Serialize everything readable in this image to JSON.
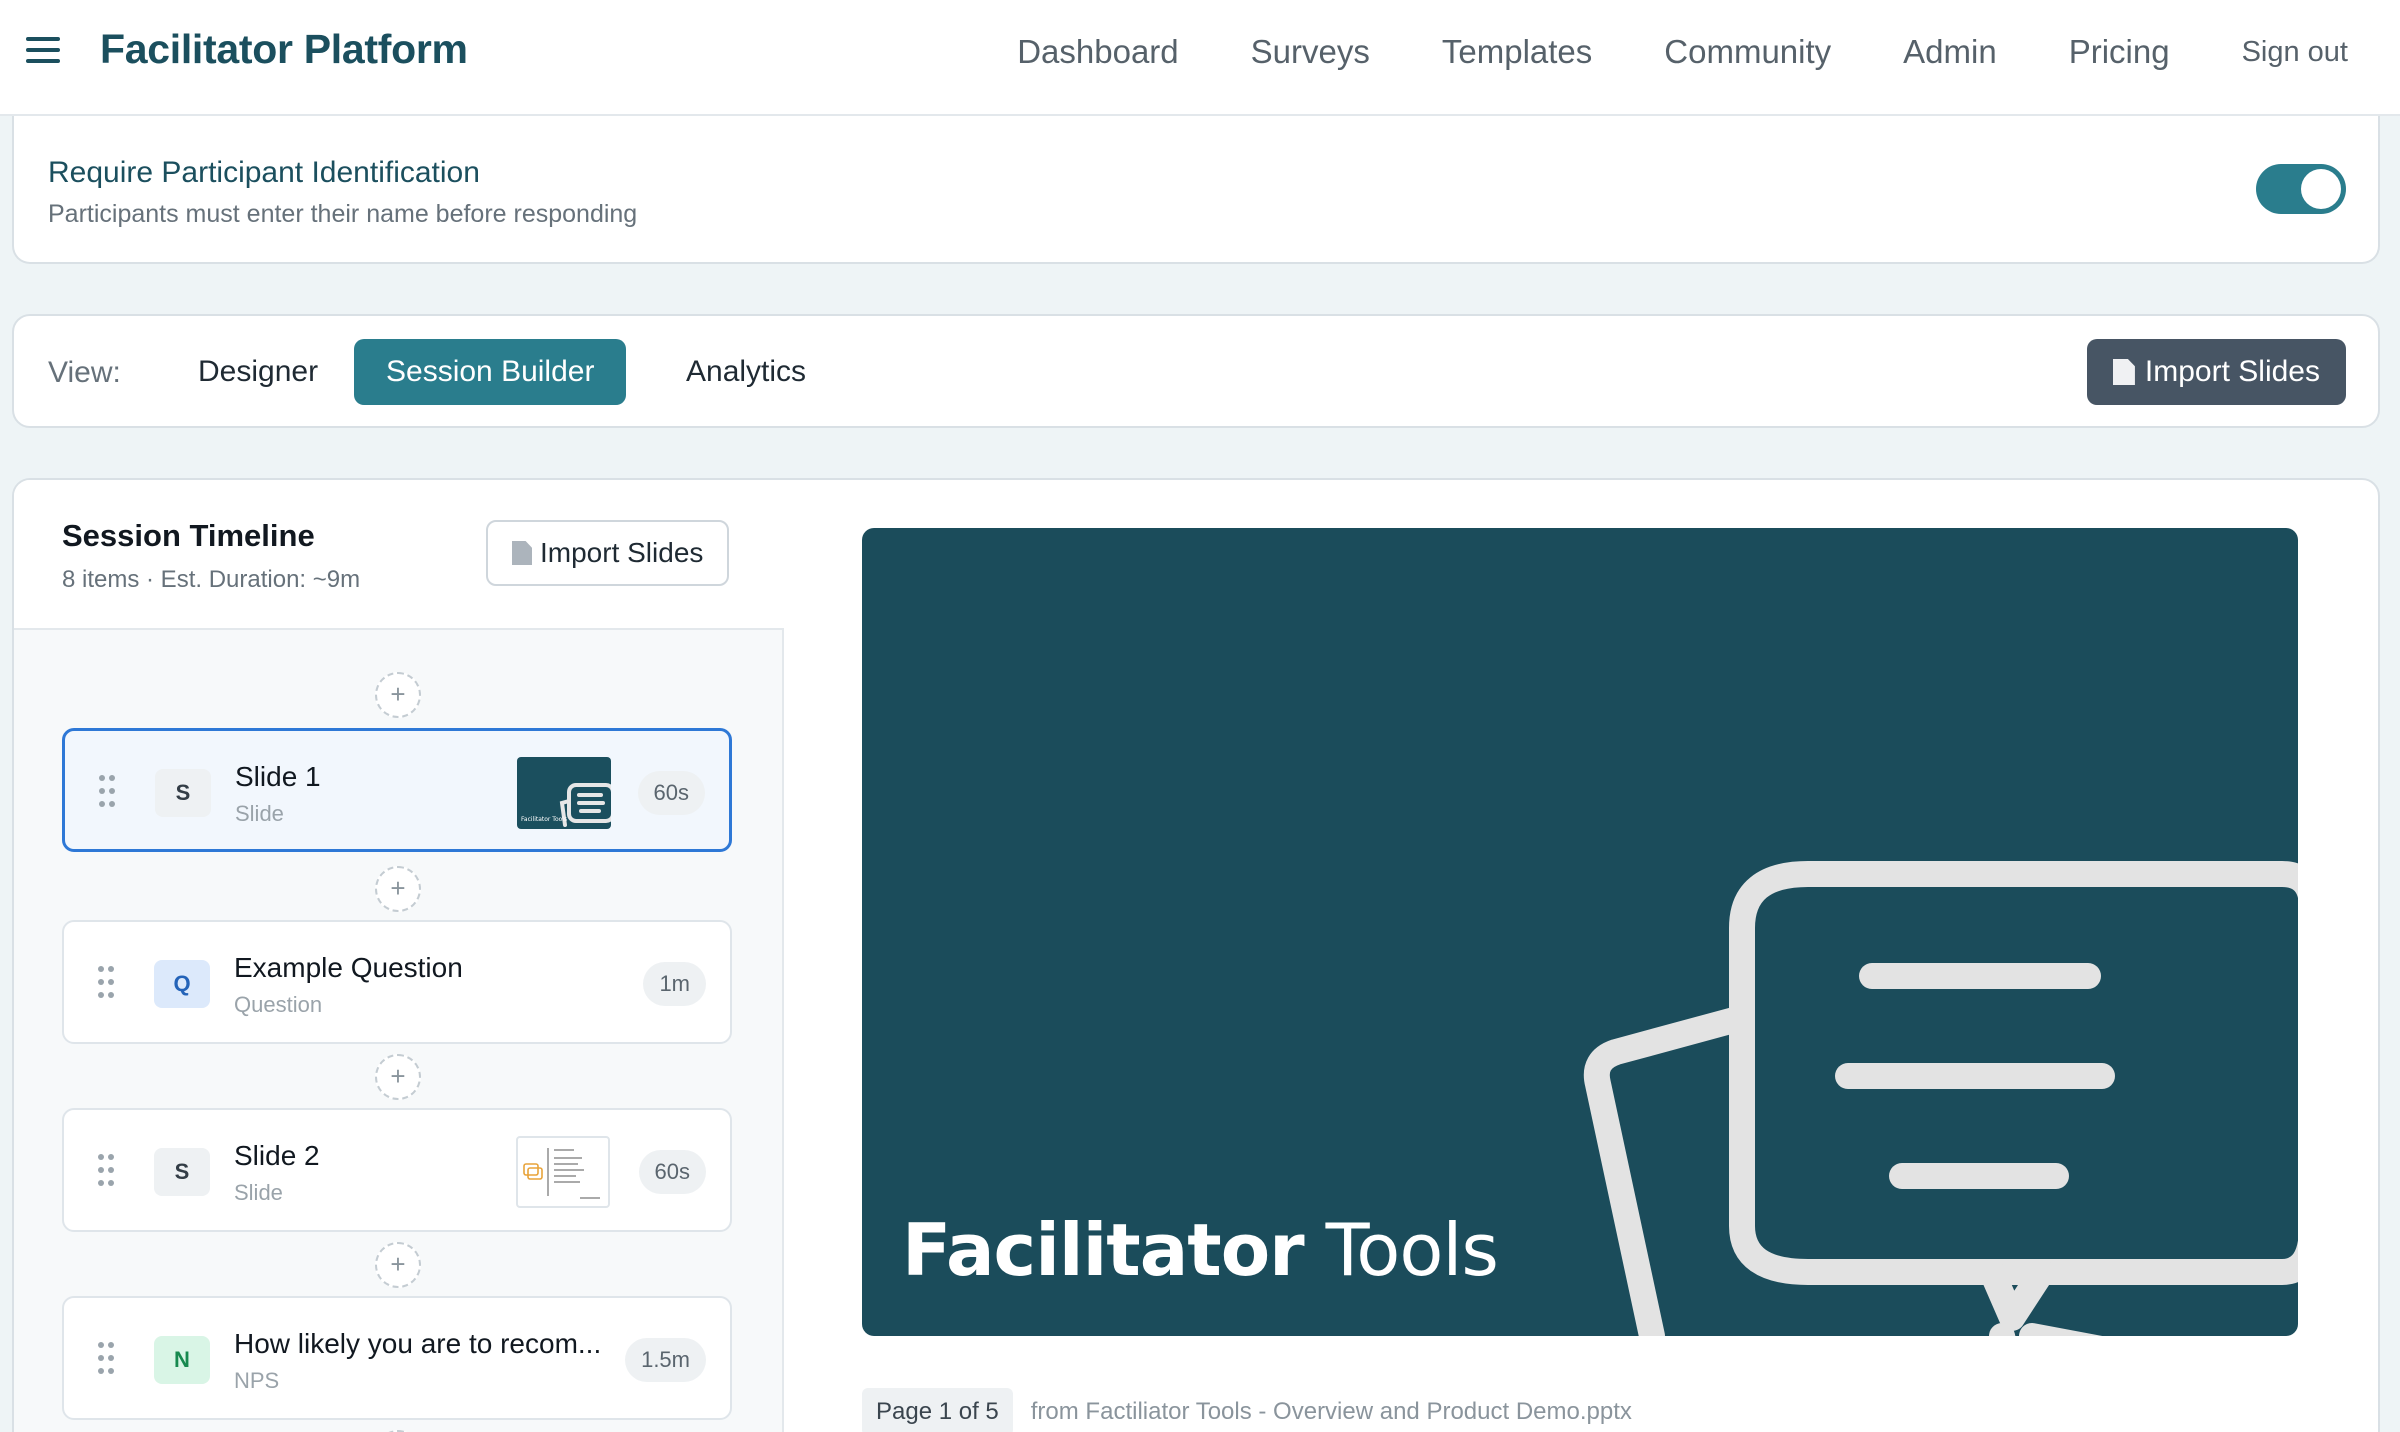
{
  "header": {
    "brand": "Facilitator Platform",
    "nav": [
      "Dashboard",
      "Surveys",
      "Templates",
      "Community",
      "Admin",
      "Pricing"
    ],
    "sign_out": "Sign out"
  },
  "settings": {
    "title": "Require Participant Identification",
    "subtitle": "Participants must enter their name before responding",
    "enabled": true
  },
  "view": {
    "label": "View:",
    "tabs": [
      "Designer",
      "Session Builder",
      "Analytics"
    ],
    "active_tab": "Session Builder",
    "import_label": "Import Slides"
  },
  "timeline": {
    "title": "Session Timeline",
    "summary": "8 items · Est. Duration: ~9m",
    "import_label": "Import Slides",
    "add_symbol": "+",
    "items": [
      {
        "badge": "S",
        "name": "Slide 1",
        "type": "Slide",
        "duration": "60s",
        "selected": true
      },
      {
        "badge": "Q",
        "name": "Example Question",
        "type": "Question",
        "duration": "1m",
        "selected": false
      },
      {
        "badge": "S",
        "name": "Slide 2",
        "type": "Slide",
        "duration": "60s",
        "selected": false
      },
      {
        "badge": "N",
        "name": "How likely you are to recom...",
        "type": "NPS",
        "duration": "1.5m",
        "selected": false
      }
    ]
  },
  "preview": {
    "title_bold": "Facilitator",
    "title_rest": "Tools",
    "thumb_caption": "Facilitator Tools",
    "page": "Page 1 of 5",
    "source": "from Factiliator Tools - Overview and Product Demo.pptx"
  },
  "colors": {
    "brand": "#1b4f5e",
    "accent": "#2a7d8d",
    "slide_bg": "#1b4c5b",
    "selected_border": "#2e78d6"
  }
}
